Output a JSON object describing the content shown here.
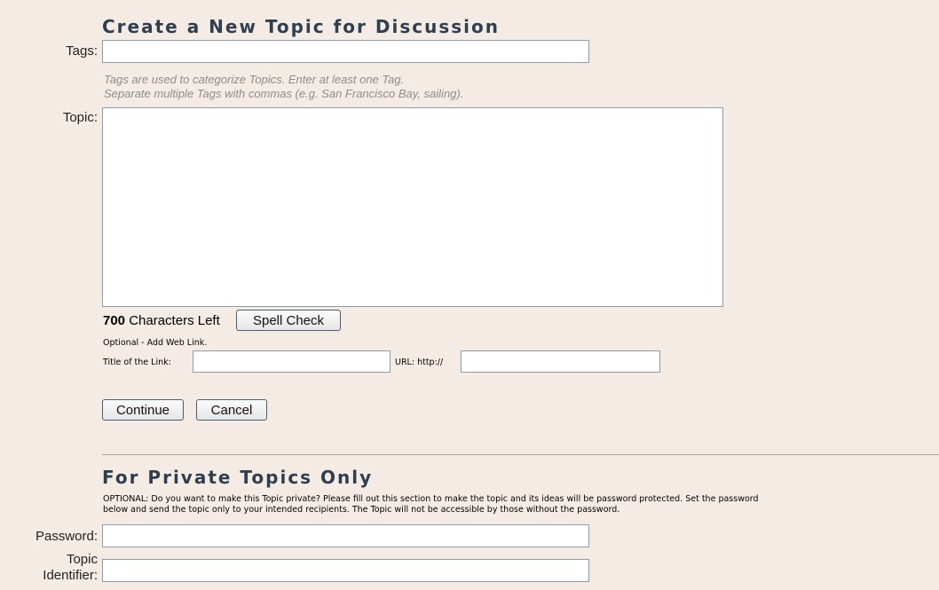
{
  "form": {
    "title": "Create a New Topic for Discussion",
    "tags_label": "Tags:",
    "tags_value": "",
    "tags_hint_line1": "Tags are used to categorize Topics. Enter at least one Tag.",
    "tags_hint_line2": "Separate multiple Tags with commas (e.g. San Francisco Bay, sailing).",
    "topic_label": "Topic:",
    "topic_value": "",
    "chars_left_count": "700",
    "chars_left_text": "Characters Left",
    "spell_check_label": "Spell Check",
    "web_link_heading": "Optional - Add Web Link.",
    "link_title_label": "Title of the Link:",
    "link_title_value": "",
    "url_label": "URL: http://",
    "url_value": "",
    "continue_label": "Continue",
    "cancel_label": "Cancel"
  },
  "private": {
    "title": "For Private Topics Only",
    "description_line1": "OPTIONAL: Do you want to make this Topic private? Please fill out this section to make the topic and its ideas will be password protected. Set the password",
    "description_line2": "below and send the topic only to your intended recipients. The Topic will not be accessible by those without the password.",
    "password_label": "Password:",
    "password_value": "",
    "identifier_label_line1": "Topic",
    "identifier_label_line2": "Identifier:",
    "identifier_value": ""
  }
}
